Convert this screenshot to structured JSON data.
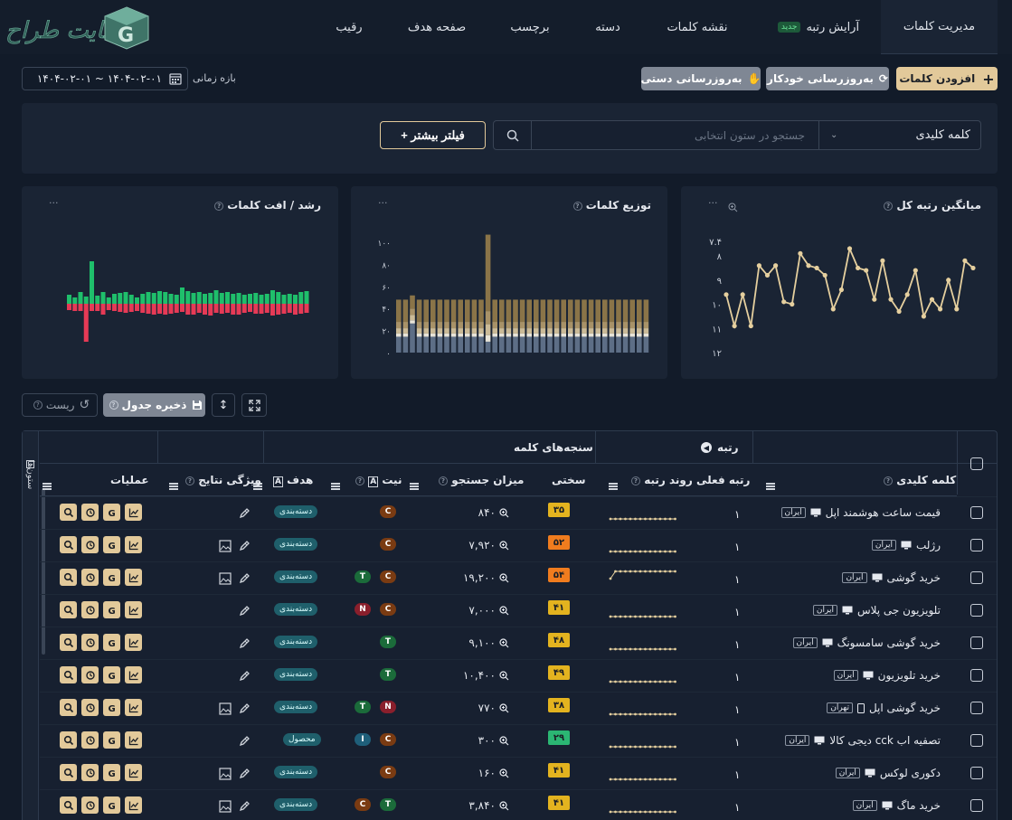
{
  "brand": {
    "logo_text": "سایت طراح"
  },
  "nav": {
    "tabs": [
      {
        "label": "مدیریت کلمات",
        "active": true
      },
      {
        "label": "آرایش رتبه",
        "badge": "جدید"
      },
      {
        "label": "نقشه کلمات"
      },
      {
        "label": "دسته"
      },
      {
        "label": "برچسب"
      },
      {
        "label": "صفحه هدف"
      },
      {
        "label": "رقیب"
      }
    ]
  },
  "actions": {
    "add_keywords": "افزودن کلمات",
    "auto_update": "به‌روزرسانی خودکار",
    "manual_update": "به‌روزرسانی دستی",
    "date_label": "بازه زمانی",
    "date_range": "۱۴۰۴-۰۲-۰۱ ~ ۱۴۰۴-۰۲-۰۱"
  },
  "filter": {
    "column_select": "کلمه کلیدی",
    "search_placeholder": "جستجو در ستون انتخابی",
    "more_filter": "+ فیلتر بیشتر"
  },
  "cards": {
    "avg_rank": {
      "title": "میانگین رتبه کل",
      "menu": "···"
    },
    "distribution": {
      "title": "توزیع کلمات",
      "menu": "···"
    },
    "growth": {
      "title": "رشد / افت کلمات",
      "menu": "···"
    }
  },
  "chart_data": [
    {
      "type": "line",
      "title": "میانگین رتبه کل",
      "y_ticks": [
        "۷.۴",
        "۸",
        "۹",
        "۱۰",
        "۱۱",
        "۱۲"
      ],
      "ylim": [
        7.4,
        12
      ],
      "y_inverted": true,
      "values": [
        9.6,
        10.9,
        9.6,
        10.9,
        8.4,
        8.8,
        8.4,
        9.9,
        10.0,
        7.9,
        8.4,
        8.5,
        8.8,
        10.2,
        9.4,
        7.7,
        8.5,
        8.6,
        9.8,
        8.2,
        9.8,
        10.3,
        9.6,
        8.6,
        10.5,
        9.8,
        10.2,
        9.0,
        10.2,
        8.2,
        8.5
      ],
      "color": "#e5cf9e"
    },
    {
      "type": "bar",
      "stacked": true,
      "title": "توزیع کلمات",
      "y_ticks": [
        "۰",
        "۲۰",
        "۴۰",
        "۶۰",
        "۸۰",
        "۱۰۰"
      ],
      "ylim": [
        0,
        100
      ],
      "totals": [
        48,
        48,
        48,
        48,
        48,
        48,
        48,
        48,
        48,
        48,
        48,
        48,
        48,
        99,
        48,
        48,
        48,
        48,
        48,
        48,
        48,
        48,
        48,
        48,
        48,
        48,
        48,
        48,
        48,
        48,
        48,
        48,
        48,
        48,
        48,
        48,
        48
      ],
      "colors": [
        "#8a7448",
        "#a89268",
        "#cbbb98",
        "#e8e4d8",
        "#5d6e86"
      ]
    },
    {
      "type": "bar",
      "title": "رشد / افت کلمات",
      "series": [
        {
          "name": "growth",
          "color": "#1fbf6b",
          "values": [
            10,
            7,
            13,
            8,
            47,
            9,
            13,
            7,
            11,
            12,
            13,
            10,
            7,
            11,
            13,
            12,
            14,
            13,
            11,
            10,
            18,
            14,
            12,
            13,
            11,
            12,
            15,
            12,
            13,
            11,
            12,
            10,
            11,
            12,
            10,
            11,
            15,
            13,
            10,
            11,
            10,
            13,
            14
          ]
        },
        {
          "name": "decline",
          "color": "#e63a56",
          "values": [
            7,
            8,
            8,
            42,
            8,
            8,
            12,
            7,
            8,
            9,
            10,
            9,
            8,
            10,
            11,
            12,
            11,
            12,
            11,
            10,
            9,
            12,
            12,
            10,
            12,
            13,
            10,
            11,
            10,
            12,
            12,
            10,
            9,
            11,
            11,
            10,
            13,
            12,
            11,
            10,
            12,
            11,
            10
          ]
        }
      ]
    }
  ],
  "toolbar": {
    "reset": "ریست",
    "save_table": "ذخیره جدول"
  },
  "table": {
    "group_rank": "رتبه",
    "group_metrics": "سنجه‌های کلمه",
    "side_label": "ستون‌ها",
    "columns": {
      "keyword": "کلمه کلیدی",
      "current_rank": "رتبه فعلی",
      "rank_trend": "روند رتبه",
      "difficulty": "سختی",
      "search_volume": "میزان جستجو",
      "intent": "نیت",
      "target": "هدف",
      "serp_features": "ویژگی نتایج",
      "actions": "عملیات"
    },
    "rows": [
      {
        "keyword": "قیمت ساعت هوشمند اپل",
        "location": "ایران",
        "device": "desktop",
        "rank": "۱",
        "difficulty": "۳۵",
        "diff_color": "#e3b31f",
        "volume": "۸۴۰",
        "intents": [
          {
            "t": "C",
            "c": "#7a3b12"
          }
        ],
        "target": "دسته‌بندی",
        "serp_image": false,
        "trend_jump": false
      },
      {
        "keyword": "رژلب",
        "location": "ایران",
        "device": "desktop",
        "rank": "۱",
        "difficulty": "۵۲",
        "diff_color": "#f07c1e",
        "volume": "۷,۹۲۰",
        "intents": [
          {
            "t": "C",
            "c": "#7a3b12"
          }
        ],
        "target": "دسته‌بندی",
        "serp_image": true,
        "trend_jump": false
      },
      {
        "keyword": "خرید گوشی",
        "location": "ایران",
        "device": "desktop",
        "rank": "۱",
        "difficulty": "۵۴",
        "diff_color": "#f07c1e",
        "volume": "۱۹,۲۰۰",
        "intents": [
          {
            "t": "C",
            "c": "#7a3b12"
          },
          {
            "t": "T",
            "c": "#1b6b3a"
          }
        ],
        "target": "دسته‌بندی",
        "serp_image": true,
        "trend_jump": true
      },
      {
        "keyword": "تلویزیون جی پلاس",
        "location": "ایران",
        "device": "desktop",
        "rank": "۱",
        "difficulty": "۴۱",
        "diff_color": "#e3b31f",
        "volume": "۷,۰۰۰",
        "intents": [
          {
            "t": "C",
            "c": "#7a3b12"
          },
          {
            "t": "N",
            "c": "#8a1f2c"
          }
        ],
        "target": "دسته‌بندی",
        "serp_image": false,
        "trend_jump": false
      },
      {
        "keyword": "خرید گوشی سامسونگ",
        "location": "ایران",
        "device": "desktop",
        "rank": "۱",
        "difficulty": "۴۸",
        "diff_color": "#e3b31f",
        "volume": "۹,۱۰۰",
        "intents": [
          {
            "t": "T",
            "c": "#1b6b3a"
          }
        ],
        "target": "دسته‌بندی",
        "serp_image": false,
        "trend_jump": false
      },
      {
        "keyword": "خرید تلویزیون",
        "location": "ایران",
        "device": "desktop",
        "rank": "۱",
        "difficulty": "۴۹",
        "diff_color": "#e3b31f",
        "volume": "۱۰,۴۰۰",
        "intents": [
          {
            "t": "T",
            "c": "#1b6b3a"
          }
        ],
        "target": "دسته‌بندی",
        "serp_image": false,
        "trend_jump": false
      },
      {
        "keyword": "خرید گوشی اپل",
        "location": "تهران",
        "device": "mobile",
        "rank": "۱",
        "difficulty": "۳۸",
        "diff_color": "#e3b31f",
        "volume": "۷۷۰",
        "intents": [
          {
            "t": "N",
            "c": "#8a1f2c"
          },
          {
            "t": "T",
            "c": "#1b6b3a"
          }
        ],
        "target": "دسته‌بندی",
        "serp_image": true,
        "trend_jump": false
      },
      {
        "keyword": "تصفیه اب cck دیجی کالا",
        "location": "ایران",
        "device": "desktop",
        "rank": "۱",
        "difficulty": "۲۹",
        "diff_color": "#2bb673",
        "volume": "۳۰۰",
        "intents": [
          {
            "t": "C",
            "c": "#7a3b12"
          },
          {
            "t": "I",
            "c": "#1f5f7a"
          }
        ],
        "target": "محصول",
        "serp_image": false,
        "trend_jump": false
      },
      {
        "keyword": "دکوری لوکس",
        "location": "ایران",
        "device": "desktop",
        "rank": "۱",
        "difficulty": "۴۱",
        "diff_color": "#e3b31f",
        "volume": "۱۶۰",
        "intents": [
          {
            "t": "C",
            "c": "#7a3b12"
          }
        ],
        "target": "دسته‌بندی",
        "serp_image": true,
        "trend_jump": false
      },
      {
        "keyword": "خرید ماگ",
        "location": "ایران",
        "device": "desktop",
        "rank": "۱",
        "difficulty": "۴۱",
        "diff_color": "#e3b31f",
        "volume": "۳,۸۴۰",
        "intents": [
          {
            "t": "T",
            "c": "#1b6b3a"
          },
          {
            "t": "C",
            "c": "#7a3b12"
          }
        ],
        "target": "دسته‌بندی",
        "serp_image": true,
        "trend_jump": false
      }
    ]
  }
}
